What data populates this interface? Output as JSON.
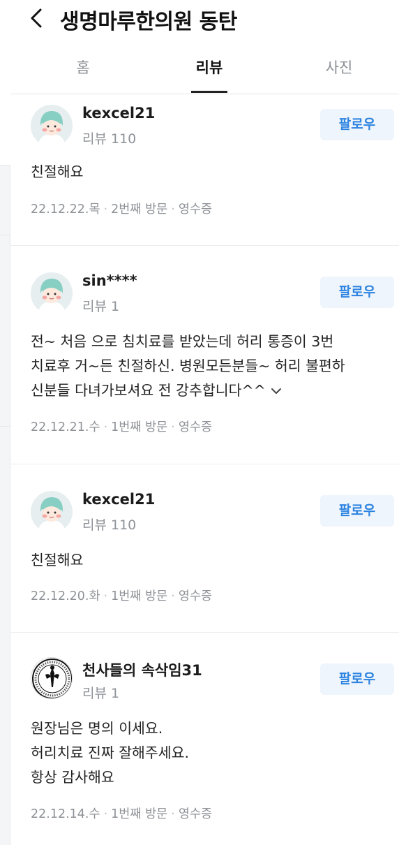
{
  "header": {
    "title": "생명마루한의원 동탄"
  },
  "tabs": [
    {
      "label": "홈",
      "active": false
    },
    {
      "label": "리뷰",
      "active": true
    },
    {
      "label": "사진",
      "active": false
    }
  ],
  "follow_label": "팔로우",
  "reviews": [
    {
      "name": "kexcel21",
      "meta": "리뷰 110",
      "avatar": "person-avatar-icon",
      "content": "친절해요",
      "date": "22.12.22.목",
      "visit": "2번째 방문",
      "receipt": "영수증"
    },
    {
      "name": "sin****",
      "meta": "리뷰 1",
      "avatar": "person-avatar-icon",
      "content": "전~ 처음 으로 침치료를 받았는데 허리 통증이 3번\n치료후 거~든 친절하신. 병원모든분들~ 허리 불편하\n신분들 다녀가보셔요 전 강추합니다^^",
      "date": "22.12.21.수",
      "visit": "1번째 방문",
      "receipt": "영수증"
    },
    {
      "name": "kexcel21",
      "meta": "리뷰 110",
      "avatar": "person-avatar-icon",
      "content": "친절해요",
      "date": "22.12.20.화",
      "visit": "1번째 방문",
      "receipt": "영수증"
    },
    {
      "name": "천사들의 속삭임31",
      "meta": "리뷰 1",
      "avatar": "emblem-logo-icon",
      "content": "원장님은 명의 이세요.\n허리치료 진짜 잘해주세요.\n항상 감사해요",
      "date": "22.12.14.수",
      "visit": "1번째 방문",
      "receipt": "영수증"
    }
  ],
  "colors": {
    "accent": "#2c83e0",
    "follow_bg": "#eef5fc",
    "muted": "#8e9297"
  }
}
